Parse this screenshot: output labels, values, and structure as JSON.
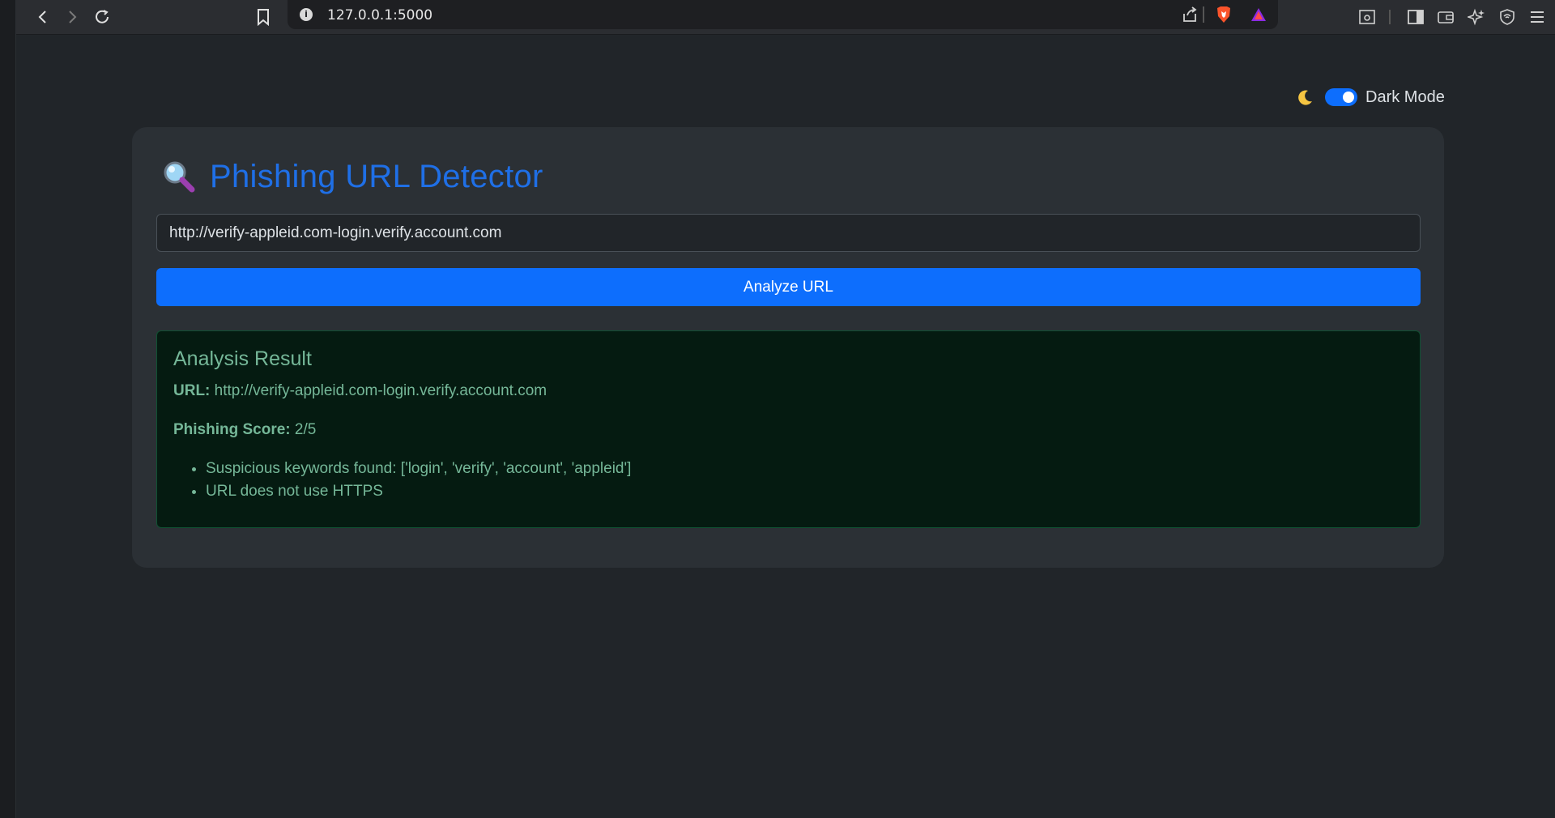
{
  "browser": {
    "url": "127.0.0.1:5000"
  },
  "theme": {
    "label": "Dark Mode",
    "enabled": true
  },
  "app": {
    "title": "Phishing URL Detector"
  },
  "form": {
    "url_value": "http://verify-appleid.com-login.verify.account.com",
    "analyze_label": "Analyze URL"
  },
  "result": {
    "heading": "Analysis Result",
    "url_label": "URL:",
    "url_value": "http://verify-appleid.com-login.verify.account.com",
    "score_label": "Phishing Score:",
    "score_value": "2/5",
    "findings": [
      "Suspicious keywords found: ['login', 'verify', 'account', 'appleid']",
      "URL does not use HTTPS"
    ]
  },
  "colors": {
    "accent": "#0d6efd",
    "success_text": "#75b798",
    "success_bg": "#051b11"
  }
}
